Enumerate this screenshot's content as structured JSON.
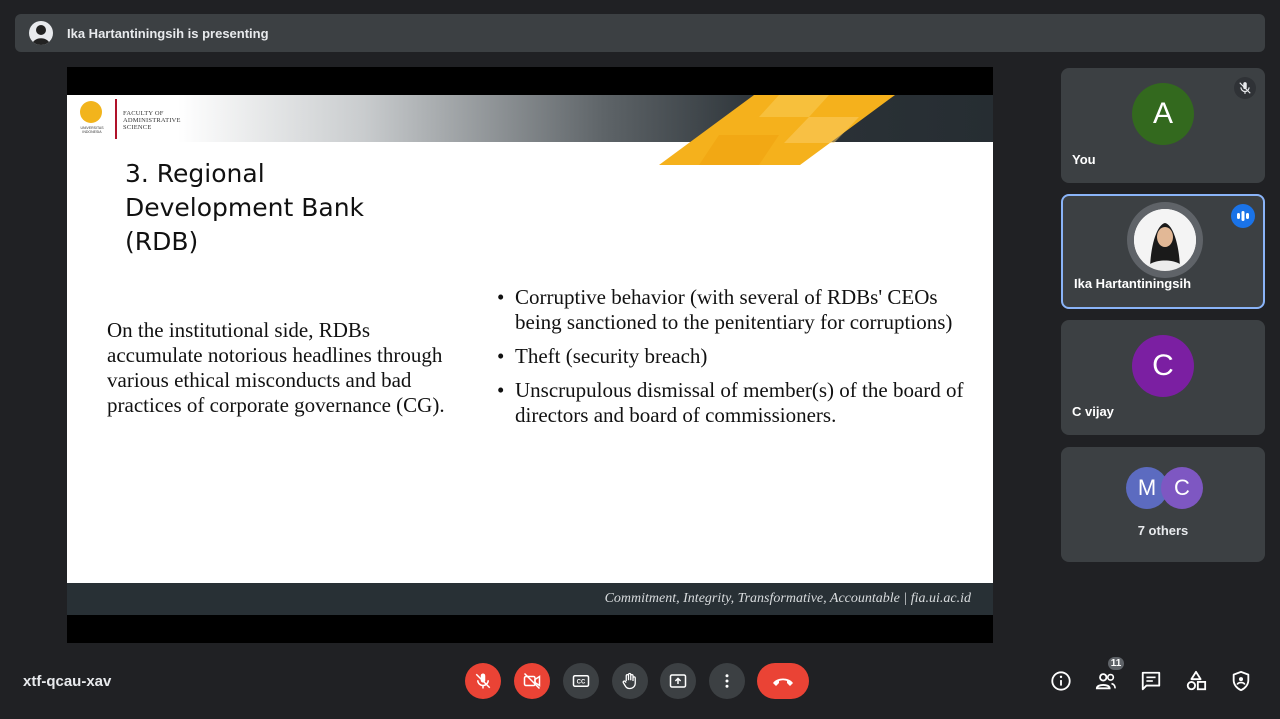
{
  "presenting": {
    "text": "Ika Hartantiningsih is presenting"
  },
  "slide": {
    "logo_lines": [
      "FACULTY OF",
      "ADMINISTRATIVE",
      "SCIENCE"
    ],
    "logo_seal_text": "UNIVERSITAS INDONESIA",
    "title_lines": [
      "3. Regional",
      "Development Bank",
      "(RDB)"
    ],
    "left_paragraph": "On the institutional side, RDBs accumulate notorious headlines through various ethical misconducts and bad practices of corporate governance (CG).",
    "bullets": [
      "Corruptive behavior (with several of RDBs' CEOs being sanctioned to the penitentiary for corruptions)",
      "Theft (security breach)",
      "Unscrupulous dismissal of member(s) of the board of directors and board of commissioners."
    ],
    "footer": "Commitment, Integrity, Transformative, Accountable | fia.ui.ac.id"
  },
  "participants": {
    "you": {
      "initial": "A",
      "name": "You",
      "color": "#33691e",
      "mic_icon": "mic-off-icon"
    },
    "ika": {
      "name": "Ika Hartantiningsih",
      "speaking_icon": "speaking-icon"
    },
    "cvijay": {
      "initial": "C",
      "name": "C vijay",
      "color": "#7b1fa2"
    },
    "others": {
      "initials": [
        "M",
        "C"
      ],
      "colors": [
        "#5c6bc0",
        "#7e57c2"
      ],
      "label": "7 others"
    }
  },
  "bottom": {
    "meeting_code": "xtf-qcau-xav",
    "people_count": "11",
    "controls": [
      "mic-off-icon",
      "camera-off-icon",
      "captions-icon",
      "raise-hand-icon",
      "present-icon",
      "more-options-icon",
      "hang-up-icon"
    ],
    "right_icons": [
      "info-icon",
      "people-icon",
      "chat-icon",
      "activities-icon",
      "host-controls-icon"
    ]
  },
  "colors": {
    "accent": "#8ab4f8",
    "danger": "#ea4335",
    "surface": "#3c4043",
    "background": "#202124",
    "slide_gold": "#f5b11c"
  }
}
